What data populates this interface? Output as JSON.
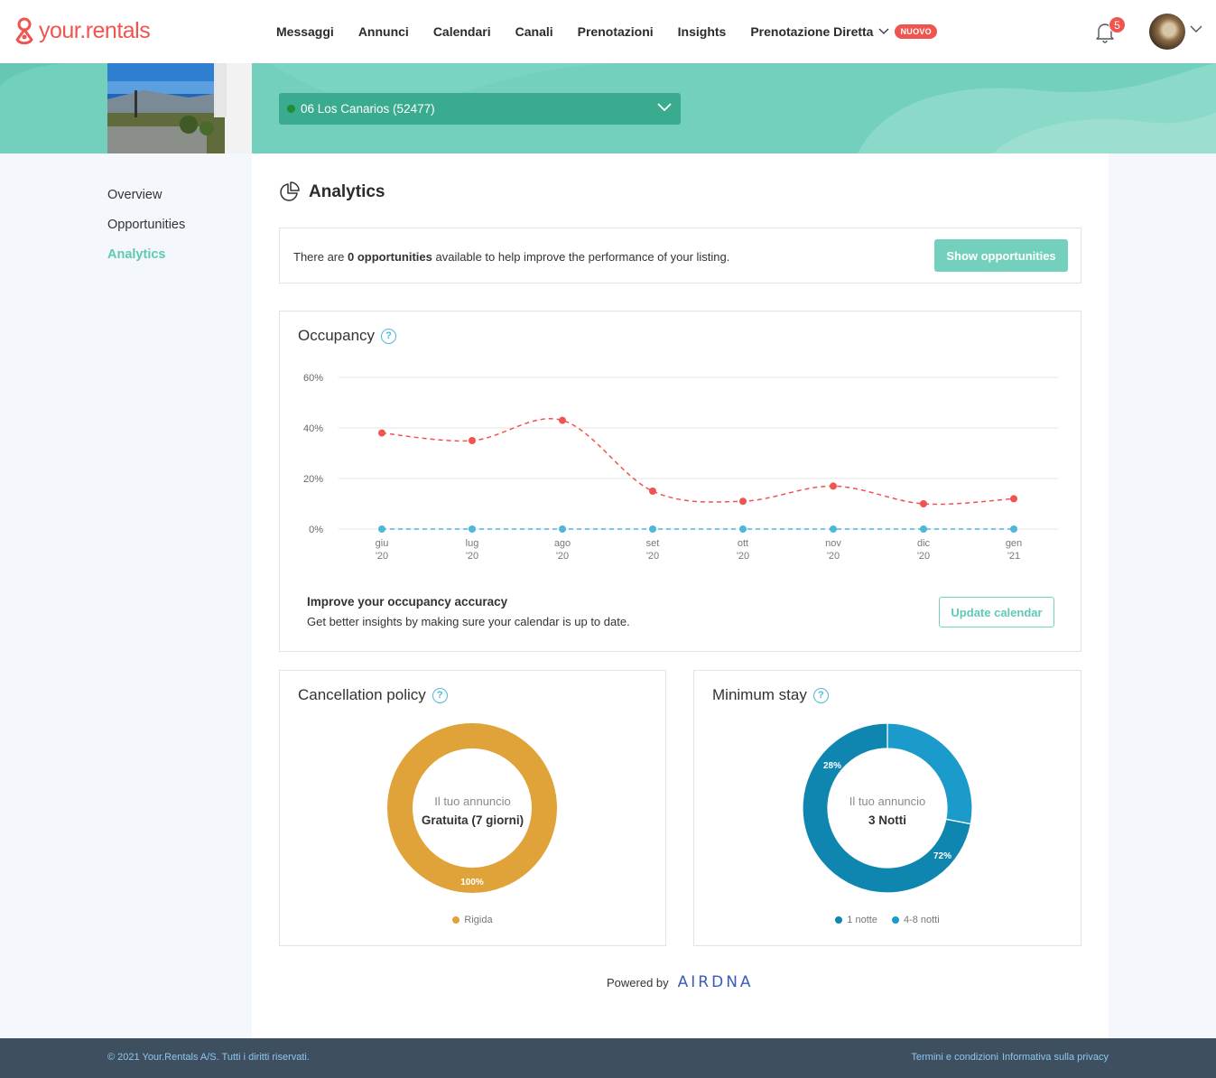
{
  "brand": {
    "name": "your.rentals",
    "color": "#f0544f"
  },
  "nav": {
    "items": [
      {
        "label": "Messaggi"
      },
      {
        "label": "Annunci"
      },
      {
        "label": "Calendari"
      },
      {
        "label": "Canali"
      },
      {
        "label": "Prenotazioni"
      },
      {
        "label": "Insights"
      },
      {
        "label": "Prenotazione Diretta",
        "badge": "NUOVO"
      }
    ],
    "notifications_count": "5"
  },
  "listing": {
    "selected": "06 Los Canarios (52477)"
  },
  "sidebar": {
    "items": [
      {
        "label": "Overview",
        "active": false
      },
      {
        "label": "Opportunities",
        "active": false
      },
      {
        "label": "Analytics",
        "active": true
      }
    ]
  },
  "page": {
    "title": "Analytics"
  },
  "opportunities": {
    "text_before": "There are ",
    "count_text": "0 opportunities",
    "text_after": " available to help improve the performance of your listing.",
    "button": "Show opportunities"
  },
  "occupancy": {
    "title": "Occupancy",
    "help": "?",
    "improve_title": "Improve your occupancy accuracy",
    "improve_sub": "Get better insights by making sure your calendar is up to date.",
    "button": "Update calendar"
  },
  "cancellation": {
    "title": "Cancellation policy",
    "help": "?",
    "center_sub": "Il tuo annuncio",
    "center_main": "Gratuita (7 giorni)",
    "legend": [
      {
        "label": "Rigida",
        "color": "#e0a33a"
      }
    ]
  },
  "minstay": {
    "title": "Minimum stay",
    "help": "?",
    "center_sub": "Il tuo annuncio",
    "center_main": "3 Notti",
    "legend": [
      {
        "label": "1 notte",
        "color": "#0f86b0"
      },
      {
        "label": "4-8 notti",
        "color": "#1b9bcc"
      }
    ]
  },
  "powered": {
    "label": "Powered by",
    "brand": "AIRDNA"
  },
  "footer": {
    "copyright": "© 2021 Your.Rentals A/S. Tutti i diritti riservati.",
    "links": [
      "Termini e condizioni",
      "Informativa sulla privacy"
    ]
  },
  "chart_data": [
    {
      "type": "line",
      "title": "Occupancy",
      "categories": [
        [
          "giu",
          "'20"
        ],
        [
          "lug",
          "'20"
        ],
        [
          "ago",
          "'20"
        ],
        [
          "set",
          "'20"
        ],
        [
          "ott",
          "'20"
        ],
        [
          "nov",
          "'20"
        ],
        [
          "dic",
          "'20"
        ],
        [
          "gen",
          "'21"
        ]
      ],
      "yticks": [
        "0%",
        "20%",
        "40%",
        "60%"
      ],
      "ylim": [
        0,
        60
      ],
      "grid": true,
      "series": [
        {
          "values": [
            38,
            35,
            43,
            15,
            11,
            17,
            10,
            12
          ],
          "color": "#f0544f",
          "dashed": true
        },
        {
          "values": [
            0,
            0,
            0,
            0,
            0,
            0,
            0,
            0
          ],
          "color": "#4fb7d9",
          "dashed": true
        }
      ]
    },
    {
      "type": "pie",
      "title": "Cancellation policy",
      "slices": [
        {
          "label": "Rigida",
          "value": 100,
          "color": "#e0a33a"
        }
      ],
      "data_labels": [
        "100%"
      ]
    },
    {
      "type": "pie",
      "title": "Minimum stay",
      "slices": [
        {
          "label": "4-8 notti",
          "value": 28,
          "color": "#1b9bcc"
        },
        {
          "label": "1 notte",
          "value": 72,
          "color": "#0f86b0"
        }
      ],
      "data_labels": [
        "28%",
        "72%"
      ]
    }
  ]
}
